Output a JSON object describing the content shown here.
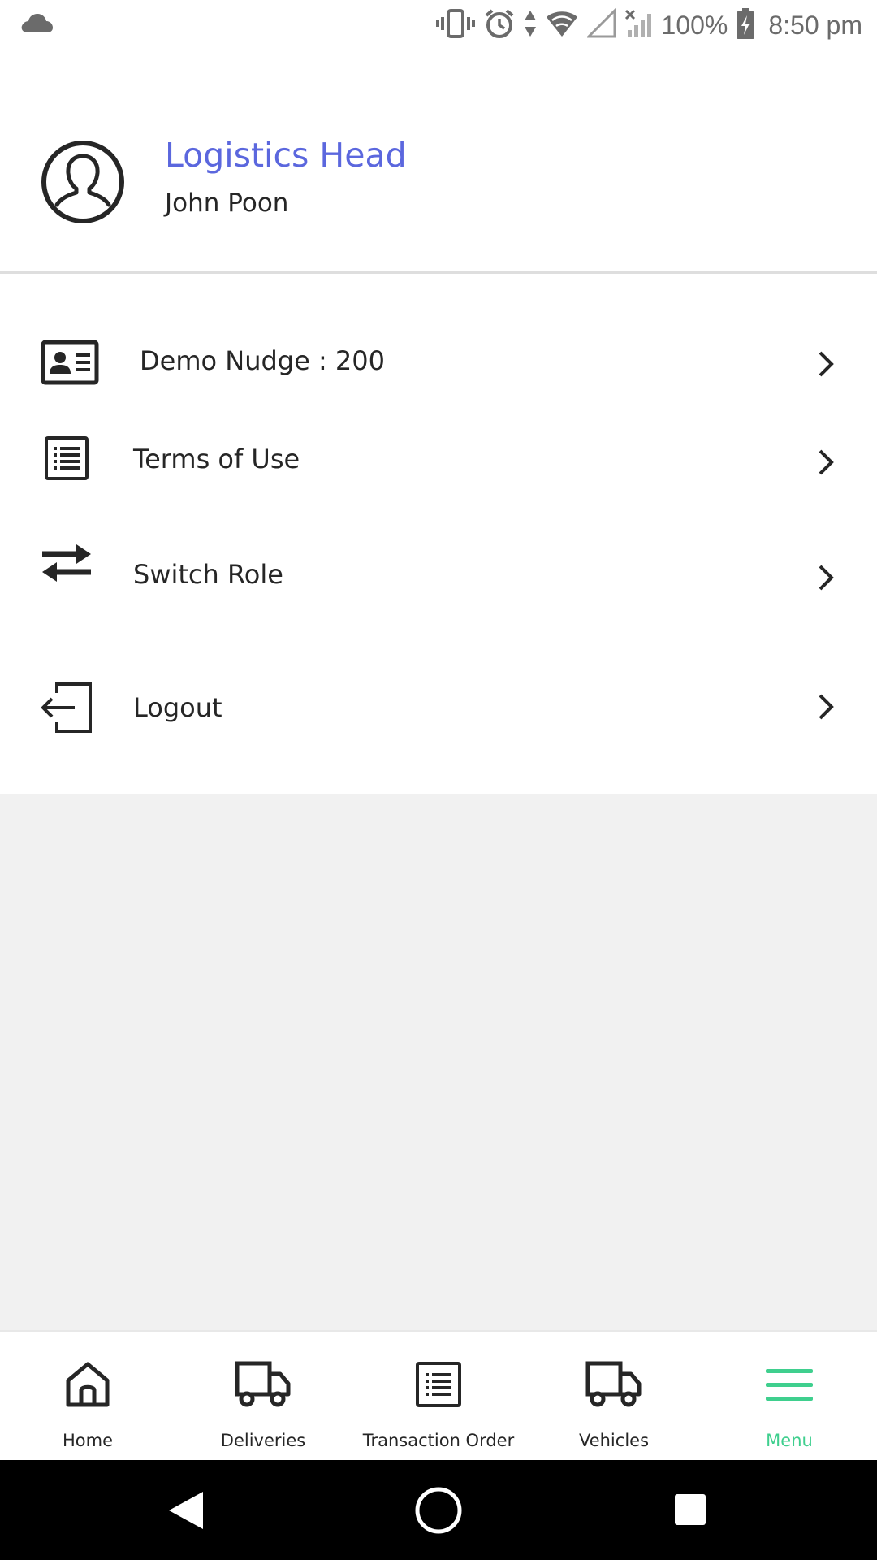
{
  "status_bar": {
    "battery": "100%",
    "time": "8:50 pm",
    "icons": [
      "cloud-icon",
      "vibrate-icon",
      "alarm-icon",
      "data-arrows-icon",
      "wifi-icon",
      "signal-icon",
      "no-signal-icon",
      "battery-charging-icon"
    ]
  },
  "profile": {
    "role": "Logistics Head",
    "name": "John Poon",
    "avatar_icon": "user-avatar-icon"
  },
  "menu": {
    "items": [
      {
        "label": "Demo Nudge : 200",
        "icon": "id-card-icon"
      },
      {
        "label": "Terms of Use",
        "icon": "document-list-icon"
      },
      {
        "label": "Switch Role",
        "icon": "switch-arrows-icon"
      },
      {
        "label": "Logout",
        "icon": "logout-icon"
      }
    ]
  },
  "bottom_nav": {
    "active": "Menu",
    "items": [
      {
        "label": "Home",
        "icon": "home-icon"
      },
      {
        "label": "Deliveries",
        "icon": "truck-icon"
      },
      {
        "label": "Transaction Order",
        "icon": "order-list-icon"
      },
      {
        "label": "Vehicles",
        "icon": "truck-icon"
      },
      {
        "label": "Menu",
        "icon": "hamburger-icon"
      }
    ]
  },
  "colors": {
    "accent_role": "#5b67de",
    "accent_active_tab": "#3fcf8e",
    "text": "#262626",
    "empty_background": "#f1f1f1"
  }
}
